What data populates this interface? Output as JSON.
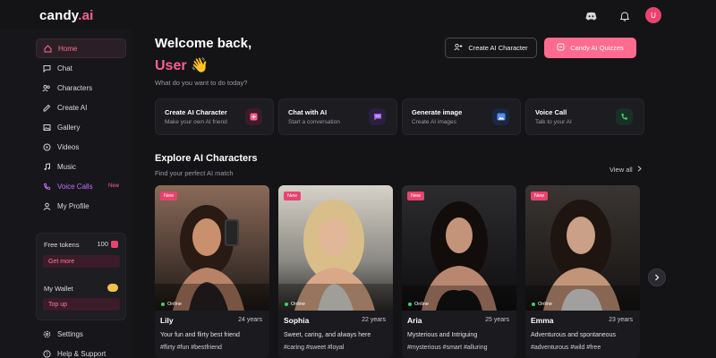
{
  "app": {
    "logo_main": "candy",
    "logo_accent": ".ai"
  },
  "header": {
    "avatar_initial": "U",
    "icons": [
      "discord-icon",
      "bell-icon"
    ]
  },
  "sidebar": {
    "items": [
      {
        "label": "Home",
        "icon": "home-icon",
        "active": true
      },
      {
        "label": "Chat",
        "icon": "chat-icon"
      },
      {
        "label": "Characters",
        "icon": "users-icon"
      },
      {
        "label": "Create AI",
        "icon": "create-icon"
      },
      {
        "label": "Gallery",
        "icon": "gallery-icon"
      },
      {
        "label": "Videos",
        "icon": "video-icon"
      },
      {
        "label": "Music",
        "icon": "music-icon"
      },
      {
        "label": "Voice Calls",
        "icon": "voice-icon",
        "tag": "New"
      },
      {
        "label": "My Profile",
        "icon": "profile-icon"
      }
    ],
    "tokens": {
      "label": "Free tokens",
      "count": "100",
      "button": "Get more"
    },
    "wallet": {
      "label": "My Wallet",
      "button": "Top up"
    },
    "bottom": [
      {
        "label": "Settings",
        "icon": "gear-icon"
      },
      {
        "label": "Help & Support",
        "icon": "help-icon"
      }
    ]
  },
  "main": {
    "welcome": "Welcome back,",
    "user": "User 👋",
    "subtitle": "What do you want to do today?",
    "btn_create": "Create AI Character",
    "btn_quizzes": "Candy AI Quizzes",
    "actions": [
      {
        "title": "Create AI Character",
        "desc": "Make your own AI friend",
        "color": "#ff5f8f"
      },
      {
        "title": "Chat with AI",
        "desc": "Start a conversation",
        "color": "#a96bff"
      },
      {
        "title": "Generate image",
        "desc": "Create AI images",
        "color": "#4d8dff"
      },
      {
        "title": "Voice Call",
        "desc": "Talk to your AI",
        "color": "#3ccf6a"
      }
    ],
    "explore_title": "Explore AI Characters",
    "explore_sub": "Find your perfect AI match",
    "view_all": "View all",
    "cards": [
      {
        "badge": "New",
        "online": "Online",
        "name": "Lily",
        "age": "24 years",
        "desc": "Your fun and flirty best friend",
        "tags": "#flirty #fun #bestfriend"
      },
      {
        "badge": "New",
        "online": "Online",
        "name": "Sophia",
        "age": "22 years",
        "desc": "Sweet, caring, and always here",
        "tags": "#caring #sweet #loyal"
      },
      {
        "badge": "New",
        "online": "Online",
        "name": "Aria",
        "age": "25 years",
        "desc": "Mysterious and Intriguing",
        "tags": "#mysterious #smart #alluring"
      },
      {
        "badge": "New",
        "online": "Online",
        "name": "Emma",
        "age": "23 years",
        "desc": "Adventurous and spontaneous",
        "tags": "#adventurous #wild #free"
      }
    ]
  }
}
